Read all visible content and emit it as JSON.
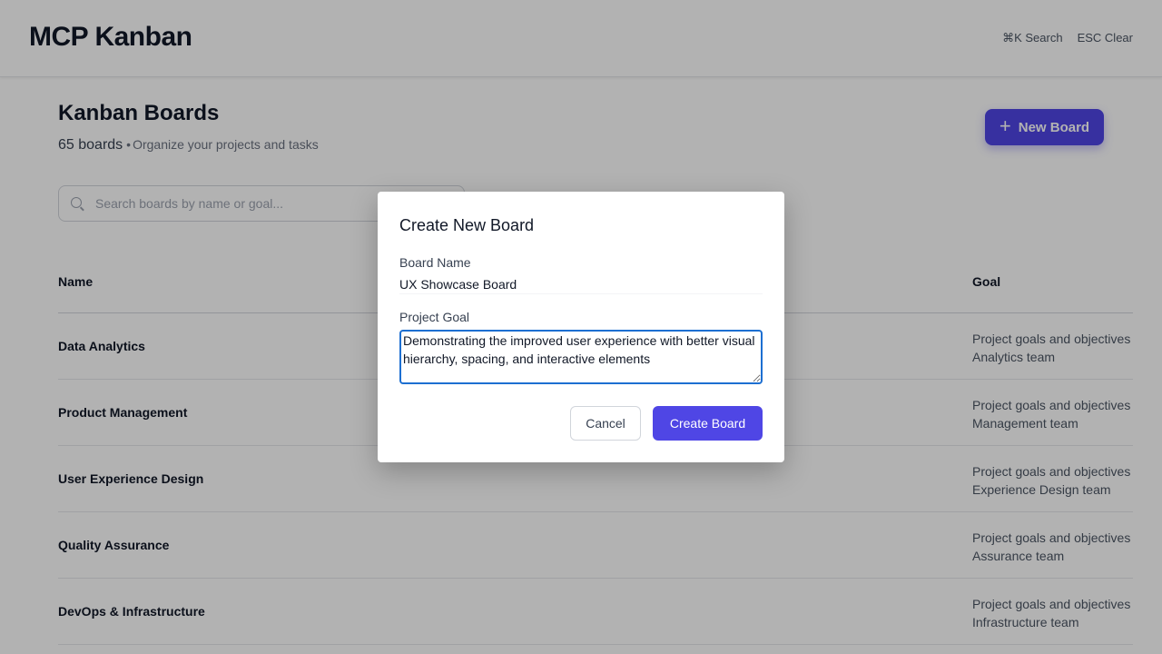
{
  "header": {
    "brand": "MCP Kanban",
    "shortcut_search": "⌘K Search",
    "shortcut_clear": "ESC Clear"
  },
  "page": {
    "title": "Kanban Boards",
    "count": "65 boards",
    "separator": "•",
    "description": "Organize your projects and tasks",
    "new_board_label": "New Board"
  },
  "search": {
    "placeholder": "Search boards by name or goal...",
    "value": ""
  },
  "table": {
    "col_name": "Name",
    "col_goal": "Goal",
    "rows": [
      {
        "name": "Data Analytics",
        "goal_line1": "Project goals and objectives for",
        "goal_line2": "Analytics team"
      },
      {
        "name": "Product Management",
        "goal_line1": "Project goals and objectives for",
        "goal_line2": "Management team"
      },
      {
        "name": "User Experience Design",
        "goal_line1": "Project goals and objectives for",
        "goal_line2": "Experience Design team"
      },
      {
        "name": "Quality Assurance",
        "goal_line1": "Project goals and objectives for",
        "goal_line2": "Assurance team"
      },
      {
        "name": "DevOps & Infrastructure",
        "goal_line1": "Project goals and objectives for",
        "goal_line2": "Infrastructure team"
      }
    ]
  },
  "modal": {
    "title": "Create New Board",
    "name_label": "Board Name",
    "name_value": "UX Showcase Board",
    "goal_label": "Project Goal",
    "goal_value": "Demonstrating the improved user experience with better visual hierarchy, spacing, and interactive elements",
    "cancel_label": "Cancel",
    "create_label": "Create Board"
  },
  "colors": {
    "accent": "#4f46e5",
    "focus_ring": "#1d6fd1",
    "overlay": "rgba(0,0,0,0.30)"
  }
}
